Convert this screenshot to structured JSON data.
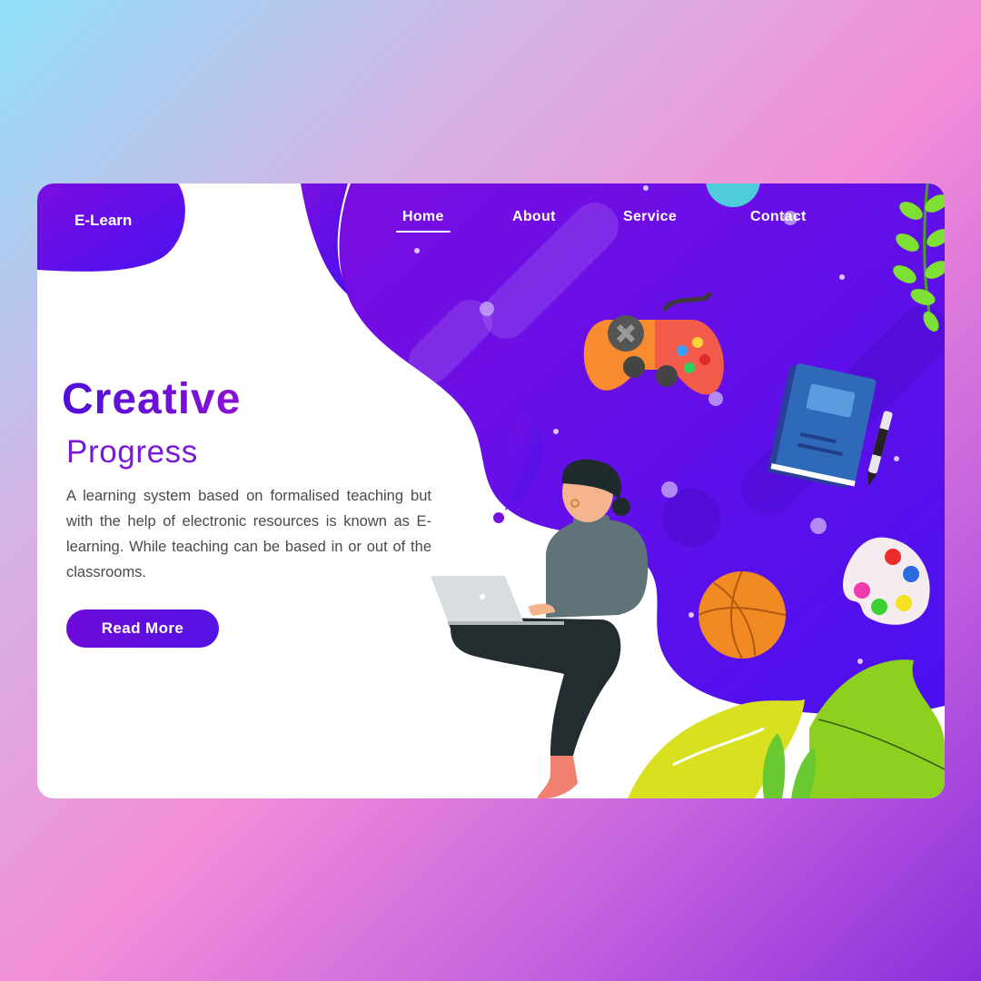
{
  "brand": {
    "logo_text": "E-Learn"
  },
  "nav": {
    "items": [
      {
        "label": "Home",
        "active": true
      },
      {
        "label": "About",
        "active": false
      },
      {
        "label": "Service",
        "active": false
      },
      {
        "label": "Contact",
        "active": false
      }
    ]
  },
  "hero": {
    "title": "Creative",
    "subtitle": "Progress",
    "description": "A learning system based on formalised teaching but with the help of electronic resources is known as E-learning. While teaching can be based in or out of the classrooms.",
    "cta_label": "Read More"
  },
  "colors": {
    "primary": "#5a10e0",
    "accent": "#7a1ad9",
    "background_gradient": [
      "#8fe0f7",
      "#f38fd8",
      "#8a2fdc"
    ]
  },
  "illustration": {
    "icons": [
      "game-controller-icon",
      "book-icon",
      "pen-icon",
      "basketball-icon",
      "palette-icon",
      "laptop-icon",
      "leaf-icon"
    ]
  }
}
